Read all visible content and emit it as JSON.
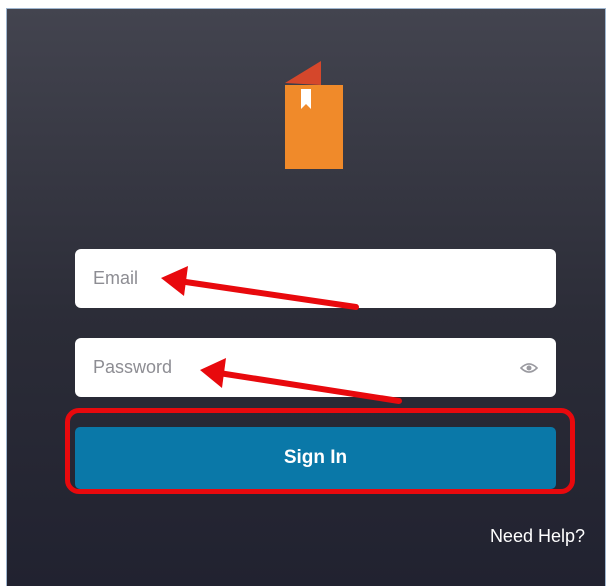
{
  "login": {
    "email_placeholder": "Email",
    "email_value": "",
    "password_placeholder": "Password",
    "password_value": "",
    "sign_in_label": "Sign In",
    "help_label": "Need Help?"
  },
  "colors": {
    "background": "#2b2c37",
    "primary_button": "#0a78a8",
    "logo_orange": "#f08a2a",
    "logo_red": "#d5472b",
    "annotation_red": "#e8090d"
  },
  "icons": {
    "logo": "book-bookmark-icon",
    "password_toggle": "eye-icon"
  },
  "annotations": {
    "arrows": [
      "email-field",
      "password-field"
    ],
    "highlight": "sign-in-button"
  }
}
